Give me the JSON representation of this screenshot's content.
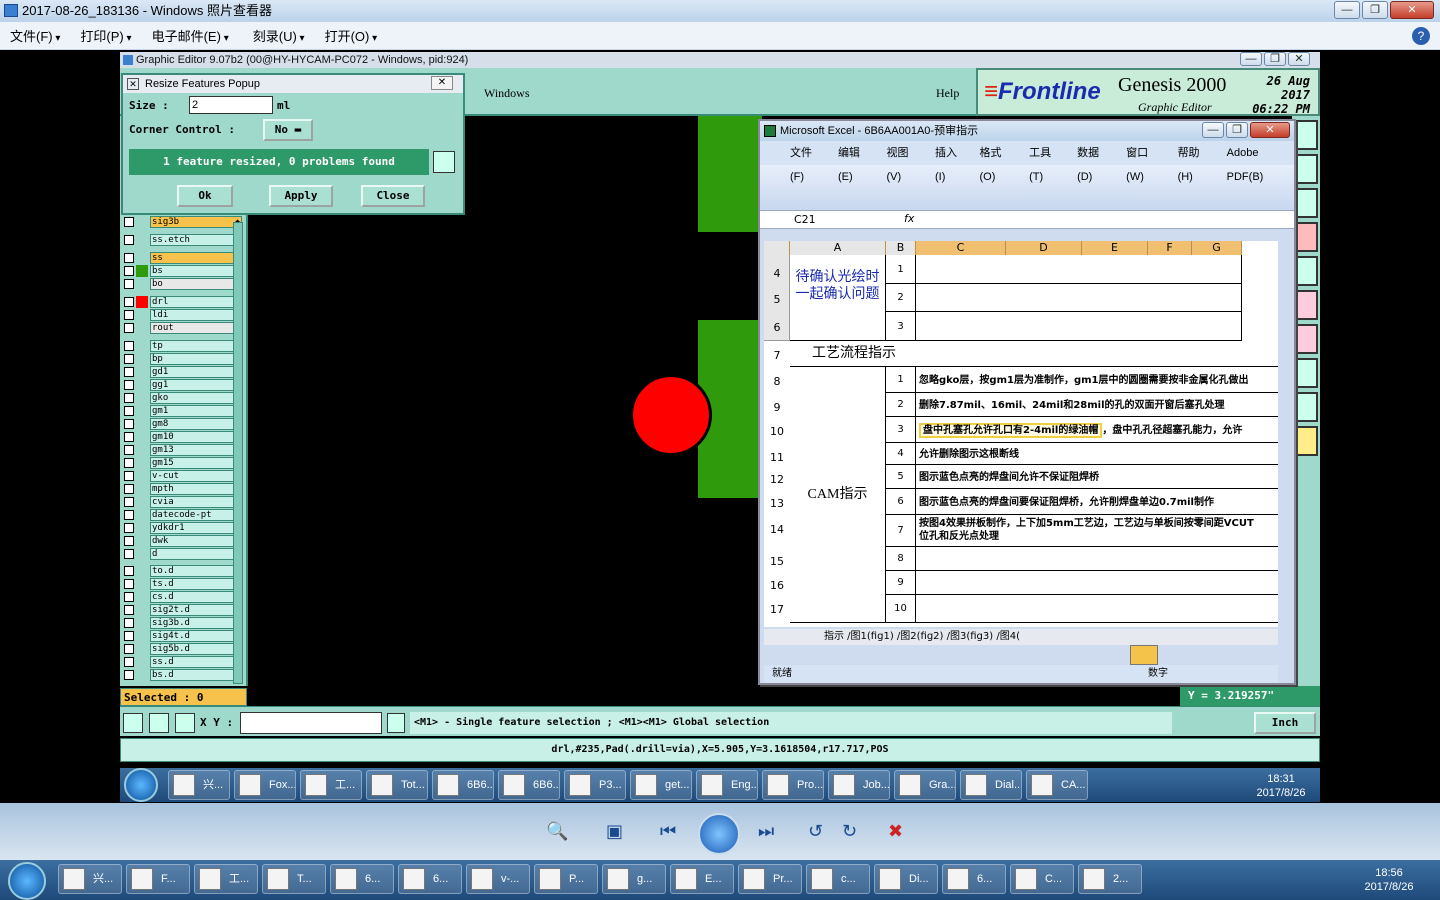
{
  "viewer": {
    "title": "2017-08-26_183136 - Windows 照片查看器",
    "menu": [
      "文件(F)",
      "打印(P)",
      "电子邮件(E)",
      "刻录(U)",
      "打开(O)"
    ],
    "help": "?"
  },
  "ge": {
    "title": "Graphic Editor 9.07b2 (00@HY-HYCAM-PC072 - Windows, pid:924)",
    "menu_windows": "Windows",
    "menu_help": "Help",
    "brand": "Frontline",
    "product": "Genesis 2000",
    "subtitle": "Graphic Editor",
    "date": "26 Aug 2017",
    "time": "06:22 PM",
    "selected": "Selected : 0",
    "xy_label": "X Y :",
    "hint": "<M1> - Single feature selection ; <M1><M1> Global selection",
    "y_readout": "Y = 3.219257\"",
    "units": "Inch",
    "status": "drl,#235,Pad(.drill=via),X=5.905,Y=3.1618504,r17.717,POS"
  },
  "layers": [
    {
      "name": "sig3b",
      "style": "y",
      "dot": "◆"
    },
    {
      "name": "ss.etch",
      "style": ""
    },
    {
      "name": "ss",
      "style": "y",
      "dot": "◆"
    },
    {
      "name": "bs",
      "style": "",
      "swatch": "#2e9a0c"
    },
    {
      "name": "bo",
      "style": "w",
      "dot": "◆"
    },
    {
      "name": "drl",
      "style": "",
      "swatch": "#ff0000"
    },
    {
      "name": "ldi",
      "style": ""
    },
    {
      "name": "rout",
      "style": "w"
    },
    {
      "name": "tp",
      "style": ""
    },
    {
      "name": "bp",
      "style": ""
    },
    {
      "name": "gd1",
      "style": "",
      "dot": "◆"
    },
    {
      "name": "gg1",
      "style": "",
      "dot": "◆"
    },
    {
      "name": "gko",
      "style": "",
      "dot": "◆"
    },
    {
      "name": "gm1",
      "style": "",
      "dot": "◆"
    },
    {
      "name": "gm8",
      "style": ""
    },
    {
      "name": "gm10",
      "style": ""
    },
    {
      "name": "gm13",
      "style": "",
      "dot": "◆"
    },
    {
      "name": "gm15",
      "style": ""
    },
    {
      "name": "v-cut",
      "style": ""
    },
    {
      "name": "mpth",
      "style": ""
    },
    {
      "name": "cvia",
      "style": ""
    },
    {
      "name": "datecode-pt",
      "style": ""
    },
    {
      "name": "ydkdr1",
      "style": ""
    },
    {
      "name": "dwk",
      "style": ""
    },
    {
      "name": "d",
      "style": ""
    },
    {
      "name": "to.d",
      "style": "",
      "dot": "◆"
    },
    {
      "name": "ts.d",
      "style": ""
    },
    {
      "name": "cs.d",
      "style": "",
      "dot": "◆"
    },
    {
      "name": "sig2t.d",
      "style": "",
      "dot": "◆"
    },
    {
      "name": "sig3b.d",
      "style": "",
      "dot": "◆"
    },
    {
      "name": "sig4t.d",
      "style": "",
      "dot": "◆"
    },
    {
      "name": "sig5b.d",
      "style": "",
      "dot": "◆"
    },
    {
      "name": "ss.d",
      "style": "",
      "dot": "◆"
    },
    {
      "name": "bs.d",
      "style": ""
    }
  ],
  "popup": {
    "title": "Resize Features Popup",
    "size_label": "Size :",
    "size_value": "2",
    "size_unit": "ml",
    "corner_label": "Corner Control :",
    "corner_value": "No",
    "result": "1 feature resized, 0 problems found",
    "ok": "Ok",
    "apply": "Apply",
    "close": "Close"
  },
  "excel": {
    "title": "Microsoft Excel - 6B6AA001A0-预审指示",
    "menu": [
      "文件(F)",
      "编辑(E)",
      "视图(V)",
      "插入(I)",
      "格式(O)",
      "工具(T)",
      "数据(D)",
      "窗口(W)",
      "帮助(H)",
      "Adobe PDF(B)"
    ],
    "cellref": "C21",
    "fx": "fx",
    "cols": [
      "A",
      "B",
      "C",
      "D",
      "E",
      "F",
      "G"
    ],
    "rows": [
      "4",
      "5",
      "6",
      "7",
      "8",
      "9",
      "10",
      "11",
      "12",
      "13",
      "14",
      "15",
      "16",
      "17"
    ],
    "a_top": "待确认光绘时一起确认问题",
    "a_flow": "工艺流程指示",
    "a_cam": "CAM指示",
    "items": [
      {
        "n": "1",
        "t": "忽略gko层，按gm1层为准制作，gm1层中的圆圈需要按非金属化孔做出"
      },
      {
        "n": "2",
        "t": "删除7.87mil、16mil、24mil和28mil的孔的双面开窗后塞孔处理"
      },
      {
        "n": "3",
        "t": "盘中孔塞孔允许孔口有2-4mil的绿油帽",
        "t2": "，盘中孔孔径超塞孔能力，允许"
      },
      {
        "n": "4",
        "t": "允许删除图示这根断线"
      },
      {
        "n": "5",
        "t": "图示蓝色点亮的焊盘间允许不保证阻焊桥"
      },
      {
        "n": "6",
        "t": "图示蓝色点亮的焊盘间要保证阻焊桥，允许削焊盘单边0.7mil制作"
      },
      {
        "n": "7",
        "t": "按图4效果拼板制作，上下加5mm工艺边，工艺边与单板间按零间距VCUT",
        "t2": "位孔和反光点处理"
      },
      {
        "n": "8",
        "t": ""
      },
      {
        "n": "9",
        "t": ""
      },
      {
        "n": "10",
        "t": ""
      }
    ],
    "top_nums": [
      "1",
      "2",
      "3"
    ],
    "sheets": "指示 /图1(fig1) /图2(fig2) /图3(fig3) /图4(",
    "status_left": "就绪",
    "status_right": "数字"
  },
  "taskbar1": {
    "items": [
      "兴...",
      "Fox...",
      "工...",
      "Tot...",
      "6B6...",
      "6B6...",
      "P3...",
      "get...",
      "Eng...",
      "Pro...",
      "Job...",
      "Gra...",
      "Dial...",
      "CA..."
    ],
    "time": "18:31",
    "date": "2017/8/26"
  },
  "taskbar2": {
    "items": [
      "兴...",
      "F...",
      "工...",
      "T...",
      "6...",
      "6...",
      "v-...",
      "P...",
      "g...",
      "E...",
      "Pr...",
      "c...",
      "Di...",
      "6...",
      "C...",
      "2..."
    ],
    "time": "18:56",
    "date": "2017/8/26"
  }
}
